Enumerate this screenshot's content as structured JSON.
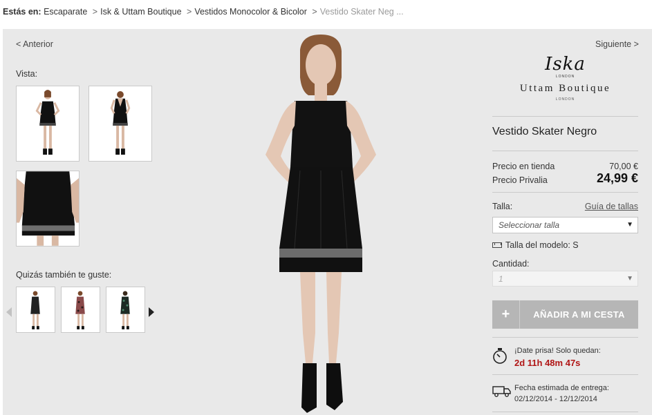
{
  "breadcrumb": {
    "label": "Estás en:",
    "items": [
      "Escaparate",
      "Isk & Uttam Boutique",
      "Vestidos Monocolor & Bicolor"
    ],
    "separator": ">",
    "current": "Vestido Skater Neg ..."
  },
  "nav": {
    "prev": "< Anterior",
    "next": "Siguiente >"
  },
  "gallery": {
    "vista_label": "Vista:",
    "suggest_label": "Quizás también te guste:"
  },
  "brand": {
    "name": "Iska",
    "sub1": "LONDON",
    "boutique": "Uttam Boutique",
    "sub2": "LONDON"
  },
  "product": {
    "name": "Vestido Skater Negro",
    "store_price_label": "Precio en tienda",
    "store_price": "70,00 €",
    "privalia_price_label": "Precio Privalia",
    "privalia_price": "24,99 €"
  },
  "size": {
    "label": "Talla:",
    "guide_link": "Guía de tallas",
    "select_placeholder": "Seleccionar talla",
    "model_size": "Talla del modelo: S"
  },
  "quantity": {
    "label": "Cantidad:",
    "value": "1"
  },
  "add_to_cart": {
    "icon": "+",
    "label": "AÑADIR A MI CESTA"
  },
  "urgency": {
    "text": "¡Date prisa! Solo quedan:",
    "countdown": "2d 11h 48m 47s"
  },
  "delivery": {
    "label": "Fecha estimada de entrega:",
    "dates": "02/12/2014 - 12/12/2014"
  },
  "colors": {
    "countdown_red": "#b01515",
    "button_gray": "#b6b6b6",
    "background_gray": "#e9e9e9"
  }
}
